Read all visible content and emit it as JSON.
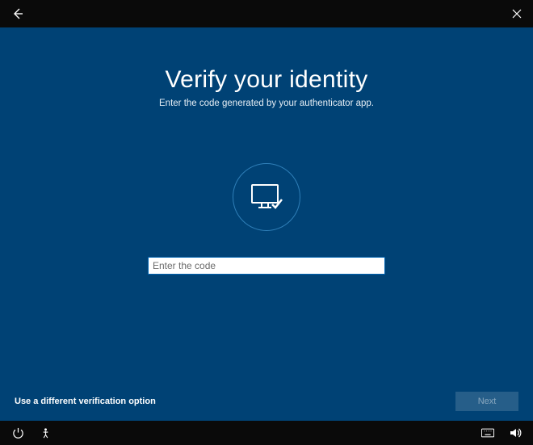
{
  "title": "Verify your identity",
  "subtitle": "Enter the code generated by your authenticator app.",
  "input": {
    "placeholder": "Enter the code",
    "value": ""
  },
  "links": {
    "alternate_verification": "Use a different verification option"
  },
  "buttons": {
    "next": "Next"
  },
  "colors": {
    "background": "#004275",
    "ring": "#2f7fb8"
  }
}
